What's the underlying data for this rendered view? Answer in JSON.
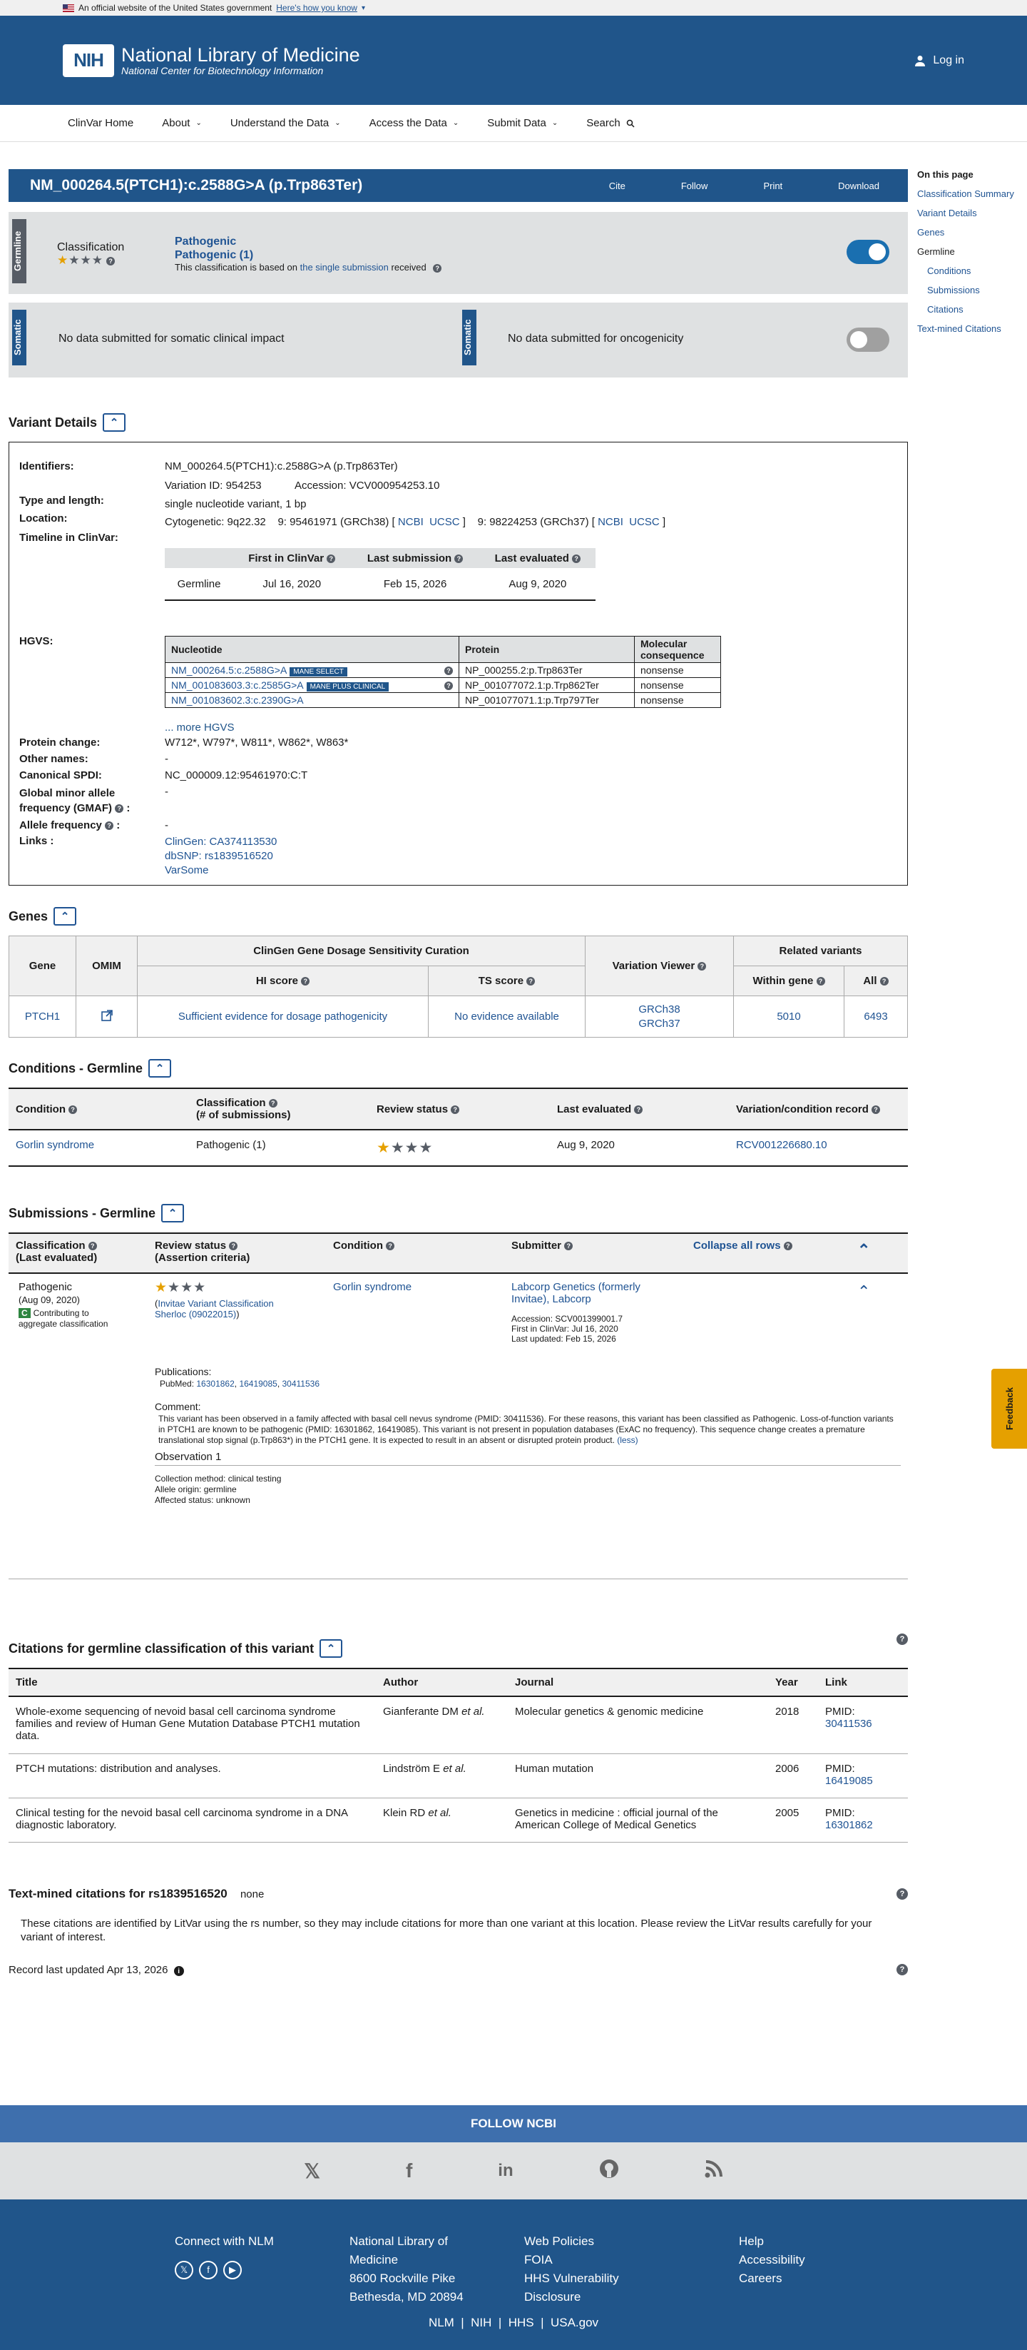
{
  "banner": {
    "text": "An official website of the United States government",
    "link": "Here's how you know"
  },
  "header": {
    "title": "National Library of Medicine",
    "subtitle": "National Center for Biotechnology Information",
    "logo": "NIH",
    "login": "Log in"
  },
  "nav": {
    "home": "ClinVar Home",
    "about": "About",
    "understand": "Understand the Data",
    "access": "Access the Data",
    "submit": "Submit Data",
    "search": "Search"
  },
  "toc": {
    "title": "On this page",
    "items": [
      "Classification Summary",
      "Variant Details",
      "Genes",
      "Germline",
      "Conditions",
      "Submissions",
      "Citations",
      "Text-mined Citations"
    ]
  },
  "title": {
    "text": "NM_000264.5(PTCH1):c.2588G>A (p.Trp863Ter)",
    "cite": "Cite",
    "follow": "Follow",
    "print": "Print",
    "download": "Download"
  },
  "germline": {
    "label": "Germline",
    "classification_label": "Classification",
    "class1": "Pathogenic",
    "class2": "Pathogenic (1)",
    "basis_pre": "This classification is based on",
    "basis_link": "the single submission",
    "basis_post": "received"
  },
  "somatic": {
    "label": "Somatic",
    "impact": "No data submitted for somatic clinical impact",
    "label2": "Somatic",
    "onco": "No data submitted for oncogenicity"
  },
  "variant_details": {
    "heading": "Variant Details",
    "identifiers_label": "Identifiers:",
    "identifiers": "NM_000264.5(PTCH1):c.2588G>A (p.Trp863Ter)",
    "variation_id": "Variation ID: 954253",
    "accession": "Accession: VCV000954253.10",
    "type_label": "Type and length:",
    "type": "single nucleotide variant, 1 bp",
    "location_label": "Location:",
    "cytogenetic": "Cytogenetic: 9q22.32",
    "loc38": "9: 95461971 (GRCh38) [",
    "loc37": "9: 98224253 (GRCh37) [",
    "ncbi": "NCBI",
    "ucsc": "UCSC",
    "close": "]",
    "timeline_label": "Timeline in ClinVar:",
    "timeline_headers": [
      "First in ClinVar",
      "Last submission",
      "Last evaluated"
    ],
    "timeline_row": [
      "Germline",
      "Jul 16, 2020",
      "Feb 15, 2026",
      "Aug 9, 2020"
    ],
    "hgvs_label": "HGVS:",
    "hgvs_headers": [
      "Nucleotide",
      "Protein",
      "Molecular consequence"
    ],
    "hgvs_rows": [
      {
        "nuc": "NM_000264.5:c.2588G>A",
        "badge": "MANE SELECT",
        "prot": "NP_000255.2:p.Trp863Ter",
        "cons": "nonsense"
      },
      {
        "nuc": "NM_001083603.3:c.2585G>A",
        "badge": "MANE PLUS CLINICAL",
        "prot": "NP_001077072.1:p.Trp862Ter",
        "cons": "nonsense"
      },
      {
        "nuc": "NM_001083602.3:c.2390G>A",
        "badge": "",
        "prot": "NP_001077071.1:p.Trp797Ter",
        "cons": "nonsense"
      }
    ],
    "more_hgvs": "... more HGVS",
    "protein_label": "Protein change:",
    "protein": "W712*, W797*, W811*, W862*, W863*",
    "other_label": "Other names:",
    "other": "-",
    "spdi_label": "Canonical SPDI:",
    "spdi": "NC_000009.12:95461970:C:T",
    "gmaf_label1": "Global minor allele",
    "gmaf_label2": "frequency (GMAF)",
    "gmaf": "-",
    "af_label": "Allele frequency",
    "af": "-",
    "links_label": "Links :",
    "links": [
      "ClinGen: CA374113530",
      "dbSNP: rs1839516520",
      "VarSome"
    ]
  },
  "genes": {
    "heading": "Genes",
    "h_gene": "Gene",
    "h_omim": "OMIM",
    "h_clingen": "ClinGen Gene Dosage Sensitivity Curation",
    "h_hi": "HI score",
    "h_ts": "TS score",
    "h_viewer": "Variation Viewer",
    "h_related": "Related variants",
    "h_within": "Within gene",
    "h_all": "All",
    "gene": "PTCH1",
    "hi": "Sufficient evidence for dosage pathogenicity",
    "ts": "No evidence available",
    "grch38": "GRCh38",
    "grch37": "GRCh37",
    "within": "5010",
    "all": "6493"
  },
  "conditions": {
    "heading": "Conditions - Germline",
    "h_condition": "Condition",
    "h_class": "Classification",
    "h_class2": "(# of submissions)",
    "h_review": "Review status",
    "h_last": "Last evaluated",
    "h_record": "Variation/condition record",
    "condition": "Gorlin syndrome",
    "classification": "Pathogenic (1)",
    "last": "Aug 9, 2020",
    "record": "RCV001226680.10"
  },
  "submissions": {
    "heading": "Submissions - Germline",
    "h_class": "Classification",
    "h_class2": "(Last evaluated)",
    "h_review": "Review status",
    "h_review2": "(Assertion criteria)",
    "h_condition": "Condition",
    "h_submitter": "Submitter",
    "collapse": "Collapse all rows",
    "classification": "Pathogenic",
    "class_date": "(Aug 09, 2020)",
    "contrib": "Contributing to aggregate classification",
    "criteria": "Invitae Variant Classification Sherloc (09022015)",
    "condition": "Gorlin syndrome",
    "submitter": "Labcorp Genetics (formerly Invitae), Labcorp",
    "accession": "Accession: SCV001399001.7",
    "first": "First in ClinVar: Jul 16, 2020",
    "updated": "Last updated: Feb 15, 2026",
    "pubs_label": "Publications:",
    "pubmed_label": "PubMed:",
    "pubmed": [
      "16301862",
      "16419085",
      "30411536"
    ],
    "comment_label": "Comment:",
    "comment": "This variant has been observed in a family affected with basal cell nevus syndrome (PMID: 30411536). For these reasons, this variant has been classified as Pathogenic. Loss-of-function variants in PTCH1 are known to be pathogenic (PMID: 16301862, 16419085). This variant is not present in population databases (ExAC no frequency). This sequence change creates a premature translational stop signal (p.Trp863*) in the PTCH1 gene. It is expected to result in an absent or disrupted protein product.",
    "less": "(less)",
    "obs": "Observation 1",
    "method": "Collection method: clinical testing",
    "origin": "Allele origin: germline",
    "affected": "Affected status: unknown"
  },
  "citations": {
    "heading": "Citations for germline classification of this variant",
    "h_title": "Title",
    "h_author": "Author",
    "h_journal": "Journal",
    "h_year": "Year",
    "h_link": "Link",
    "rows": [
      {
        "title": "Whole-exome sequencing of nevoid basal cell carcinoma syndrome families and review of Human Gene Mutation Database PTCH1 mutation data.",
        "author": "Gianferante DM",
        "journal": "Molecular genetics & genomic medicine",
        "year": "2018",
        "pmid": "30411536"
      },
      {
        "title": "PTCH mutations: distribution and analyses.",
        "author": "Lindström E",
        "journal": "Human mutation",
        "year": "2006",
        "pmid": "16419085"
      },
      {
        "title": "Clinical testing for the nevoid basal cell carcinoma syndrome in a DNA diagnostic laboratory.",
        "author": "Klein RD",
        "journal": "Genetics in medicine : official journal of the American College of Medical Genetics",
        "year": "2005",
        "pmid": "16301862"
      }
    ],
    "etal": "et al.",
    "pmid_label": "PMID:"
  },
  "textmined": {
    "heading": "Text-mined citations for rs1839516520",
    "none": "none",
    "desc": "These citations are identified by LitVar using the rs number, so they may include citations for more than one variant at this location. Please review the LitVar results carefully for your variant of interest."
  },
  "record": "Record last updated Apr 13, 2026",
  "feedback": "Feedback",
  "footer": {
    "follow": "FOLLOW NCBI",
    "connect": "Connect with NLM",
    "addr": [
      "National Library of",
      "Medicine",
      "8600 Rockville Pike",
      "Bethesda, MD 20894"
    ],
    "col3": [
      "Web Policies",
      "FOIA",
      "HHS Vulnerability",
      "Disclosure"
    ],
    "col4": [
      "Help",
      "Accessibility",
      "Careers"
    ],
    "bottom": [
      "NLM",
      "NIH",
      "HHS",
      "USA.gov"
    ]
  },
  "colors": {
    "primary": "#20558a",
    "link": "#205493",
    "gold": "#e5a000",
    "gray": "#dfe1e2"
  }
}
